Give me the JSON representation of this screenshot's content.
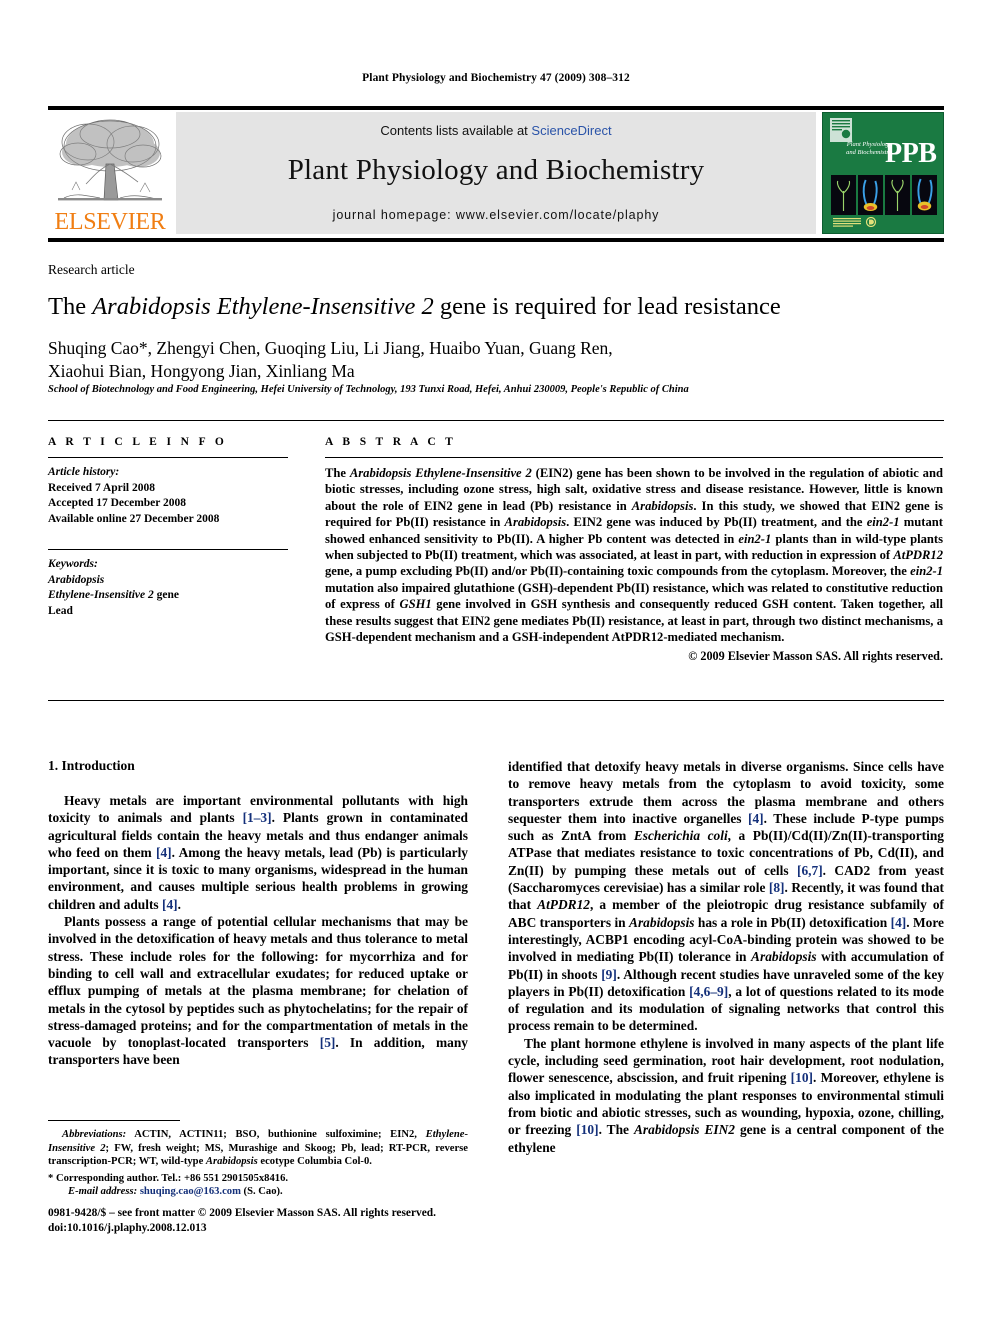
{
  "running_head": "Plant Physiology and Biochemistry 47 (2009) 308–312",
  "masthead": {
    "publisher_name": "ELSEVIER",
    "contents_prefix": "Contents lists available at ",
    "contents_link": "ScienceDirect",
    "journal_title": "Plant Physiology and Biochemistry",
    "homepage": "journal homepage: www.elsevier.com/locate/plaphy",
    "cover": {
      "small_title": "Plant Physiology and Biochemistry",
      "abbrev": "PPB"
    }
  },
  "article": {
    "type_label": "Research article",
    "title_plain_1": "The ",
    "title_italic": "Arabidopsis Ethylene-Insensitive 2",
    "title_plain_2": " gene is required for lead resistance",
    "authors_line1": "Shuqing Cao*, Zhengyi Chen, Guoqing Liu, Li Jiang, Huaibo Yuan, Guang Ren,",
    "authors_line2": "Xiaohui Bian, Hongyong Jian, Xinliang Ma",
    "affiliation": "School of Biotechnology and Food Engineering, Hefei University of Technology, 193 Tunxi Road, Hefei, Anhui 230009, People's Republic of China"
  },
  "article_info": {
    "heading": "A R T I C L E   I N F O",
    "history_label": "Article history:",
    "received": "Received 7 April 2008",
    "accepted": "Accepted 17 December 2008",
    "available": "Available online 27 December 2008",
    "keywords_label": "Keywords:",
    "keyword_1": "Arabidopsis",
    "keyword_2_italic": "Ethylene-Insensitive 2",
    "keyword_2_plain": " gene",
    "keyword_3": "Lead"
  },
  "abstract": {
    "heading": "A B S T R A C T",
    "p1_a": "The ",
    "p1_it1": "Arabidopsis Ethylene-Insensitive 2",
    "p1_b": " (EIN2) gene has been shown to be involved in the regulation of abiotic and biotic stresses, including ozone stress, high salt, oxidative stress and disease resistance. However, little is known about the role of EIN2 gene in lead (Pb) resistance in ",
    "p1_it2": "Arabidopsis",
    "p1_c": ". In this study, we showed that EIN2 gene is required for Pb(II) resistance in ",
    "p1_it3": "Arabidopsis",
    "p1_d": ". EIN2 gene was induced by Pb(II) treatment, and the ",
    "p1_it4": "ein2-1",
    "p1_e": " mutant showed enhanced sensitivity to Pb(II). A higher Pb content was detected in ",
    "p1_it5": "ein2-1",
    "p1_f": " plants than in wild-type plants when subjected to Pb(II) treatment, which was associated, at least in part, with reduction in expression of ",
    "p1_it6": "AtPDR12",
    "p1_g": " gene, a pump excluding Pb(II) and/or Pb(II)-containing toxic compounds from the cytoplasm. Moreover, the ",
    "p1_it7": "ein2-1",
    "p1_h": " mutation also impaired glutathione (GSH)-dependent Pb(II) resistance, which was related to constitutive reduction of express of ",
    "p1_it8": "GSH1",
    "p1_i": " gene involved in GSH synthesis and consequently reduced GSH content. Taken together, all these results suggest that EIN2 gene mediates Pb(II) resistance, at least in part, through two distinct mechanisms, a GSH-dependent mechanism and a GSH-independent AtPDR12-mediated mechanism.",
    "copyright": "© 2009 Elsevier Masson SAS. All rights reserved."
  },
  "body": {
    "section_1_heading": "1.  Introduction",
    "left_p1_a": "Heavy metals are important environmental pollutants with high toxicity to animals and plants ",
    "left_p1_r1": "[1–3]",
    "left_p1_b": ". Plants grown in contaminated agricultural fields contain the heavy metals and thus endanger animals who feed on them ",
    "left_p1_r2": "[4]",
    "left_p1_c": ". Among the heavy metals, lead (Pb) is particularly important, since it is toxic to many organisms, widespread in the human environment, and causes multiple serious health problems in growing children and adults ",
    "left_p1_r3": "[4]",
    "left_p1_d": ".",
    "left_p2_a": "Plants possess a range of potential cellular mechanisms that may be involved in the detoxification of heavy metals and thus tolerance to metal stress. These include roles for the following: for mycorrhiza and for binding to cell wall and extracellular exudates; for reduced uptake or efflux pumping of metals at the plasma membrane; for chelation of metals in the cytosol by peptides such as phytochelatins; for the repair of stress-damaged proteins; and for the compartmentation of metals in the vacuole by tonoplast-located transporters ",
    "left_p2_r1": "[5]",
    "left_p2_b": ". In addition, many transporters have been",
    "right_p1_a": "identified that detoxify heavy metals in diverse organisms. Since cells have to remove heavy metals from the cytoplasm to avoid toxicity, some transporters extrude them across the plasma membrane and others sequester them into inactive organelles ",
    "right_p1_r1": "[4]",
    "right_p1_b": ". These include P-type pumps such as ZntA from ",
    "right_p1_it1": "Escherichia coli",
    "right_p1_c": ", a Pb(II)/Cd(II)/Zn(II)-transporting ATPase that mediates resistance to toxic concentrations of Pb, Cd(II), and Zn(II) by pumping these metals out of cells ",
    "right_p1_r2": "[6,7]",
    "right_p1_d": ". CAD2 from yeast (Saccharomyces cerevisiae) has a similar role ",
    "right_p1_r3": "[8]",
    "right_p1_e": ". Recently, it was found that that ",
    "right_p1_it2": "AtPDR12",
    "right_p1_f": ", a member of the pleiotropic drug resistance subfamily of ABC transporters in ",
    "right_p1_it3": "Arabidopsis",
    "right_p1_g": " has a role in Pb(II) detoxification ",
    "right_p1_r4": "[4]",
    "right_p1_h": ". More interestingly, ACBP1 encoding acyl-CoA-binding protein was showed to be involved in mediating Pb(II) tolerance in ",
    "right_p1_it4": "Arabidopsis",
    "right_p1_i": " with accumulation of Pb(II) in shoots ",
    "right_p1_r5": "[9]",
    "right_p1_j": ". Although recent studies have unraveled some of the key players in Pb(II) detoxification ",
    "right_p1_r6": "[4,6–9]",
    "right_p1_k": ", a lot of questions related to its mode of regulation and its modulation of signaling networks that control this process remain to be determined.",
    "right_p2_a": "The plant hormone ethylene is involved in many aspects of the plant life cycle, including seed germination, root hair development, root nodulation, flower senescence, abscission, and fruit ripening ",
    "right_p2_r1": "[10]",
    "right_p2_b": ". Moreover, ethylene is also implicated in modulating the plant responses to environmental stimuli from biotic and abiotic stresses, such as wounding, hypoxia, ozone, chilling, or freezing ",
    "right_p2_r2": "[10]",
    "right_p2_c": ". The ",
    "right_p2_it1": "Arabidopsis EIN2",
    "right_p2_d": " gene is a central component of the ethylene"
  },
  "footnotes": {
    "abbrev_label": "Abbreviations:",
    "abbrev_a": " ACTIN, ACTIN11; BSO, buthionine sulfoximine; EIN2, ",
    "abbrev_it1": "Ethylene-Insensitive 2",
    "abbrev_b": "; FW, fresh weight; MS, Murashige and Skoog; Pb, lead; RT-PCR, reverse transcription-PCR; WT, wild-type ",
    "abbrev_it2": "Arabidopsis",
    "abbrev_c": " ecotype Columbia Col-0.",
    "corresponding": "* Corresponding author. Tel.: +86 551 2901505x8416.",
    "email_label": "E-mail address:",
    "email_value": "shuqing.cao@163.com",
    "email_suffix": " (S. Cao).",
    "imprint_line1": "0981-9428/$ – see front matter © 2009 Elsevier Masson SAS. All rights reserved.",
    "imprint_line2": "doi:10.1016/j.plaphy.2008.12.013"
  },
  "colors": {
    "elsevier_orange": "#F07E13",
    "link_blue": "#2a53a8",
    "reference_blue": "#14307a",
    "band_gray": "#e4e4e4",
    "cover_green": "#1a7a42"
  }
}
